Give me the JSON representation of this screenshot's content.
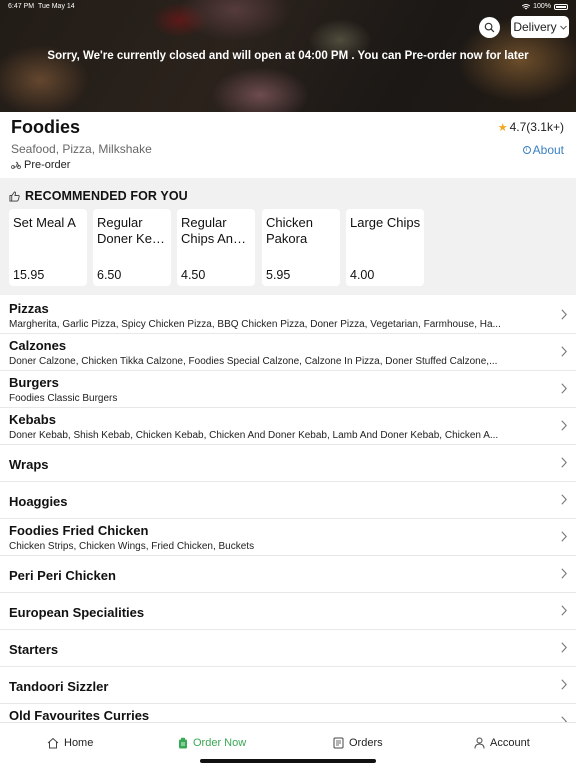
{
  "status_bar": {
    "time": "6:47 PM",
    "date": "Tue May 14",
    "battery": "100%"
  },
  "header": {
    "delivery_label": "Delivery",
    "closed_message": "Sorry, We're currently closed and will open at 04:00 PM . You can Pre-order now for later"
  },
  "restaurant": {
    "name": "Foodies",
    "rating": "4.7(3.1k+)",
    "cuisines": "Seafood, Pizza, Milkshake",
    "about_label": "About",
    "preorder_label": "Pre-order"
  },
  "recommended": {
    "title": "RECOMMENDED FOR YOU",
    "items": [
      {
        "name": "Set Meal A",
        "price": "15.95"
      },
      {
        "name": "Regular Doner Ke…",
        "price": "6.50"
      },
      {
        "name": "Regular Chips An…",
        "price": "4.50"
      },
      {
        "name": "Chicken Pakora",
        "price": "5.95"
      },
      {
        "name": "Large Chips",
        "price": "4.00"
      }
    ]
  },
  "categories": [
    {
      "title": "Pizzas",
      "subtitle": "Margherita, Garlic Pizza, Spicy Chicken Pizza, BBQ Chicken Pizza, Doner Pizza, Vegetarian, Farmhouse, Ha..."
    },
    {
      "title": "Calzones",
      "subtitle": "Doner Calzone, Chicken Tikka Calzone, Foodies Special Calzone, Calzone In Pizza, Doner Stuffed Calzone,..."
    },
    {
      "title": "Burgers",
      "subtitle": "Foodies Classic Burgers"
    },
    {
      "title": "Kebabs",
      "subtitle": "Doner Kebab, Shish Kebab, Chicken Kebab, Chicken And Doner Kebab, Lamb And Doner Kebab, Chicken A..."
    },
    {
      "title": "Wraps",
      "subtitle": ""
    },
    {
      "title": "Hoaggies",
      "subtitle": ""
    },
    {
      "title": "Foodies Fried Chicken",
      "subtitle": "Chicken Strips, Chicken Wings, Fried Chicken, Buckets"
    },
    {
      "title": "Peri Peri Chicken",
      "subtitle": ""
    },
    {
      "title": "European Specialities",
      "subtitle": ""
    },
    {
      "title": "Starters",
      "subtitle": ""
    },
    {
      "title": "Tandoori Sizzler",
      "subtitle": ""
    },
    {
      "title": "Old Favourites Curries",
      "subtitle": ""
    }
  ],
  "bottom_nav": {
    "home": "Home",
    "order_now": "Order Now",
    "orders": "Orders",
    "account": "Account"
  },
  "colors": {
    "accent_green": "#3aa955",
    "link_blue": "#3a7fc1",
    "star": "#f5a623"
  }
}
